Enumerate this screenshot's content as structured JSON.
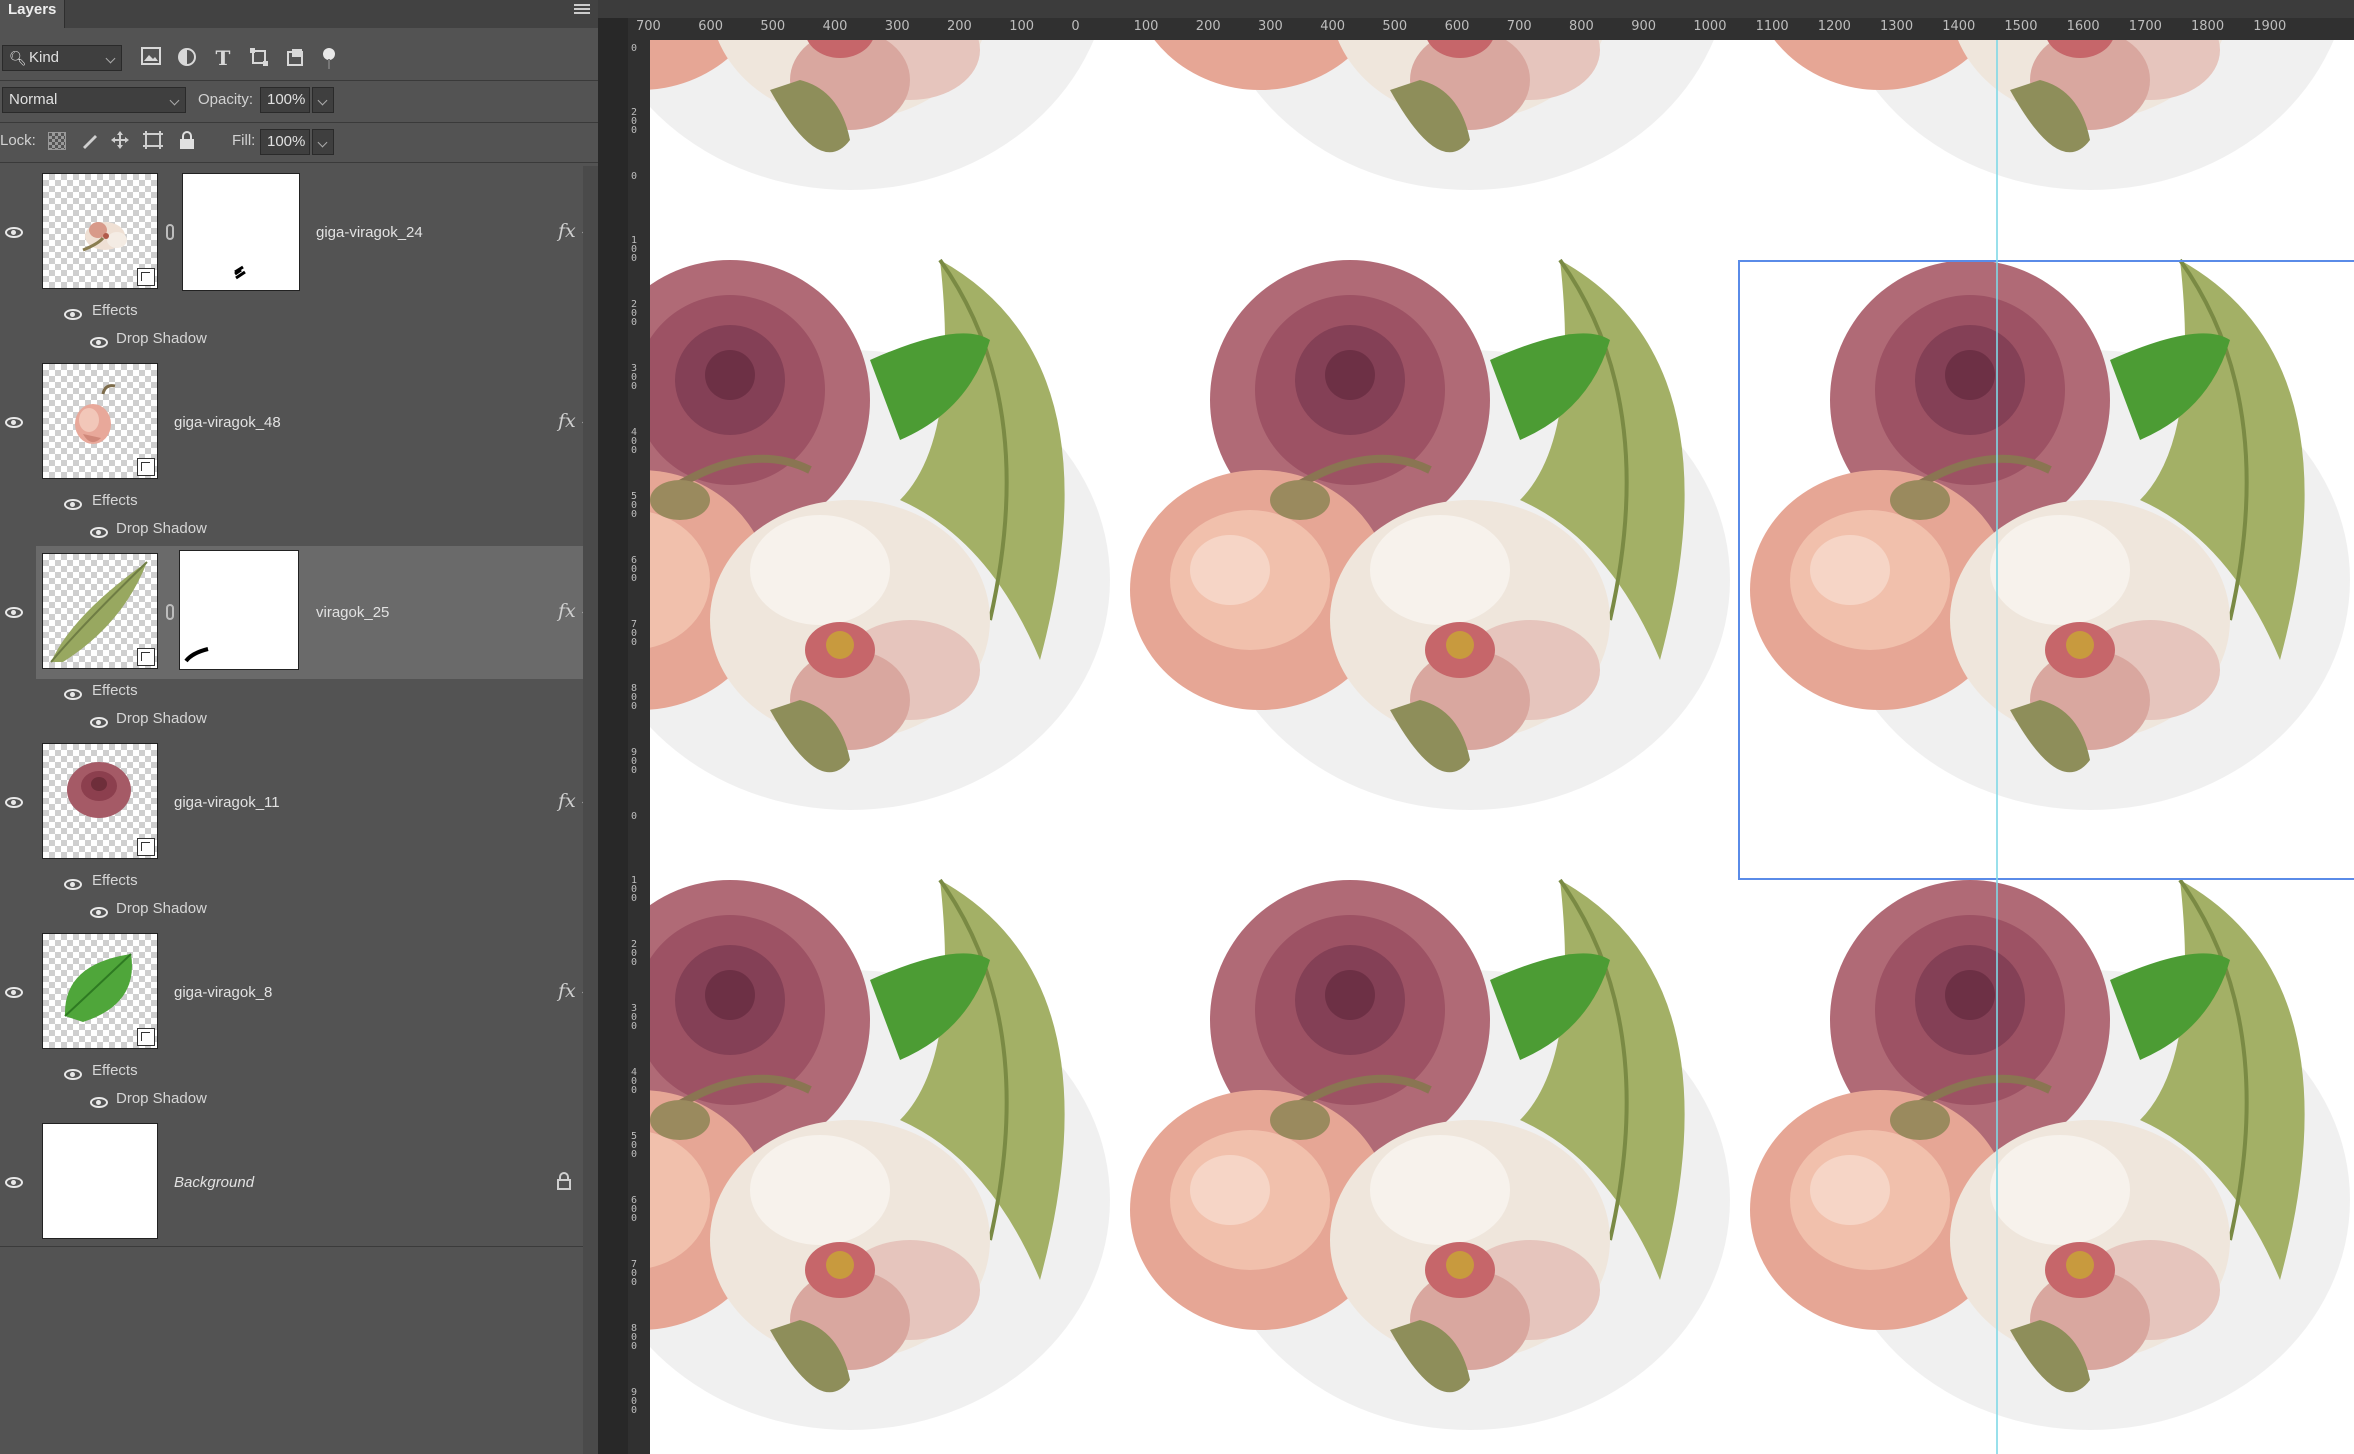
{
  "panel": {
    "title": "Layers",
    "filter_kind": "Kind",
    "blend_mode": "Normal",
    "opacity_label": "Opacity:",
    "opacity_value": "100%",
    "lock_label": "Lock:",
    "fill_label": "Fill:",
    "fill_value": "100%"
  },
  "layers": [
    {
      "name": "giga-viragok_24",
      "effects_label": "Effects",
      "effect": "Drop Shadow",
      "fx": "fx"
    },
    {
      "name": "giga-viragok_48",
      "effects_label": "Effects",
      "effect": "Drop Shadow",
      "fx": "fx"
    },
    {
      "name": "viragok_25",
      "effects_label": "Effects",
      "effect": "Drop Shadow",
      "fx": "fx"
    },
    {
      "name": "giga-viragok_11",
      "effects_label": "Effects",
      "effect": "Drop Shadow",
      "fx": "fx"
    },
    {
      "name": "giga-viragok_8",
      "effects_label": "Effects",
      "effect": "Drop Shadow",
      "fx": "fx"
    },
    {
      "name": "Background"
    }
  ],
  "ruler_top": [
    "700",
    "600",
    "500",
    "400",
    "300",
    "200",
    "100",
    "0",
    "100",
    "200",
    "300",
    "400",
    "500",
    "600",
    "700",
    "800",
    "900",
    "1000",
    "1100",
    "1200",
    "1300",
    "1400",
    "1500",
    "1600",
    "1700",
    "1800",
    "1900"
  ],
  "ruler_left": [
    "0",
    "200",
    "0",
    "100",
    "200",
    "300",
    "400",
    "500",
    "600",
    "700",
    "800",
    "900",
    "0",
    "100",
    "200",
    "300",
    "400",
    "500",
    "600",
    "700",
    "800",
    "900"
  ],
  "icons": {
    "filter": [
      "search-icon",
      "image-filter-icon",
      "adjustment-filter-icon",
      "type-filter-icon",
      "shape-filter-icon",
      "smart-object-filter-icon",
      "filter-toggle-icon"
    ],
    "lock": [
      "lock-transparent-icon",
      "lock-pixels-icon",
      "lock-position-icon",
      "lock-artboard-icon",
      "lock-all-icon"
    ]
  },
  "colors": {
    "selection": "#5a8be8",
    "guide": "#7fd8e6",
    "selected_row": "#6a6a6a"
  }
}
